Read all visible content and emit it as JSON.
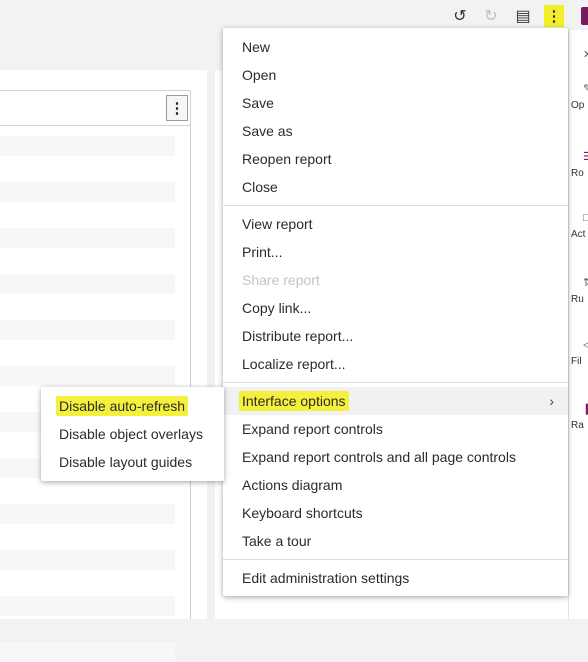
{
  "toolbar": {
    "undo_icon": "undo-icon",
    "redo_icon": "redo-icon",
    "save_icon": "save-icon",
    "more_icon": "more-vertical-icon",
    "brand_color": "#7a1b5a",
    "highlight_color": "#f5f03c"
  },
  "report_object": {
    "menu_icon": "more-vertical-icon"
  },
  "right_rail": {
    "items": [
      {
        "label": "Op",
        "icon": "options-icon"
      },
      {
        "label": "Ro",
        "icon": "roles-icon"
      },
      {
        "label": "Act",
        "icon": "actions-icon"
      },
      {
        "label": "Ru",
        "icon": "rules-icon"
      },
      {
        "label": "Fil",
        "icon": "filters-icon"
      },
      {
        "label": "Ra",
        "icon": "ranks-icon"
      }
    ]
  },
  "main_menu": {
    "group1": [
      "New",
      "Open",
      "Save",
      "Save as",
      "Reopen report",
      "Close"
    ],
    "group2": [
      "View report",
      "Print...",
      "Share report",
      "Copy link...",
      "Distribute report...",
      "Localize report..."
    ],
    "group2_disabled_index": 2,
    "group3": [
      "Interface options",
      "Expand report controls",
      "Expand report controls and all page controls",
      "Actions diagram",
      "Keyboard shortcuts",
      "Take a tour"
    ],
    "group4": [
      "Edit administration settings"
    ]
  },
  "sub_menu": {
    "items": [
      "Disable auto-refresh",
      "Disable object overlays",
      "Disable layout guides"
    ]
  }
}
